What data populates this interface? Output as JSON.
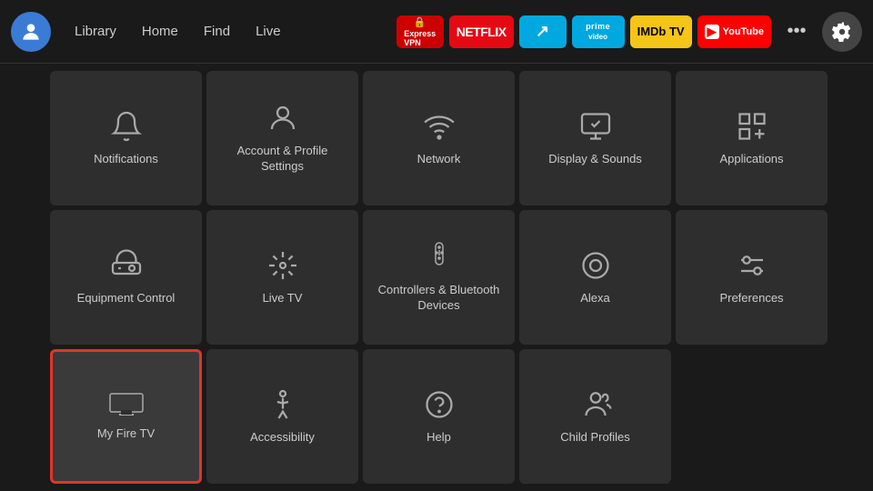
{
  "nav": {
    "links": [
      {
        "label": "Library",
        "id": "library"
      },
      {
        "label": "Home",
        "id": "home"
      },
      {
        "label": "Find",
        "id": "find"
      },
      {
        "label": "Live",
        "id": "live"
      }
    ],
    "apps": [
      {
        "label": "ExpressVPN",
        "id": "expressvpn",
        "class": "badge-express"
      },
      {
        "label": "NETFLIX",
        "id": "netflix",
        "class": "badge-netflix"
      },
      {
        "label": "↗",
        "id": "arrow",
        "class": "badge-prime"
      },
      {
        "label": "prime video",
        "id": "prime",
        "class": "badge-prime"
      },
      {
        "label": "IMDb TV",
        "id": "imdb",
        "class": "badge-imdb"
      },
      {
        "label": "▶ YouTube",
        "id": "youtube",
        "class": "badge-youtube"
      }
    ],
    "more_label": "•••",
    "settings_label": "⚙"
  },
  "grid": {
    "items": [
      {
        "id": "notifications",
        "label": "Notifications",
        "selected": false
      },
      {
        "id": "account-profile",
        "label": "Account & Profile Settings",
        "selected": false
      },
      {
        "id": "network",
        "label": "Network",
        "selected": false
      },
      {
        "id": "display-sounds",
        "label": "Display & Sounds",
        "selected": false
      },
      {
        "id": "applications",
        "label": "Applications",
        "selected": false
      },
      {
        "id": "equipment-control",
        "label": "Equipment Control",
        "selected": false
      },
      {
        "id": "live-tv",
        "label": "Live TV",
        "selected": false
      },
      {
        "id": "controllers-bluetooth",
        "label": "Controllers & Bluetooth Devices",
        "selected": false
      },
      {
        "id": "alexa",
        "label": "Alexa",
        "selected": false
      },
      {
        "id": "preferences",
        "label": "Preferences",
        "selected": false
      },
      {
        "id": "my-fire-tv",
        "label": "My Fire TV",
        "selected": true
      },
      {
        "id": "accessibility",
        "label": "Accessibility",
        "selected": false
      },
      {
        "id": "help",
        "label": "Help",
        "selected": false
      },
      {
        "id": "child-profiles",
        "label": "Child Profiles",
        "selected": false
      }
    ]
  }
}
